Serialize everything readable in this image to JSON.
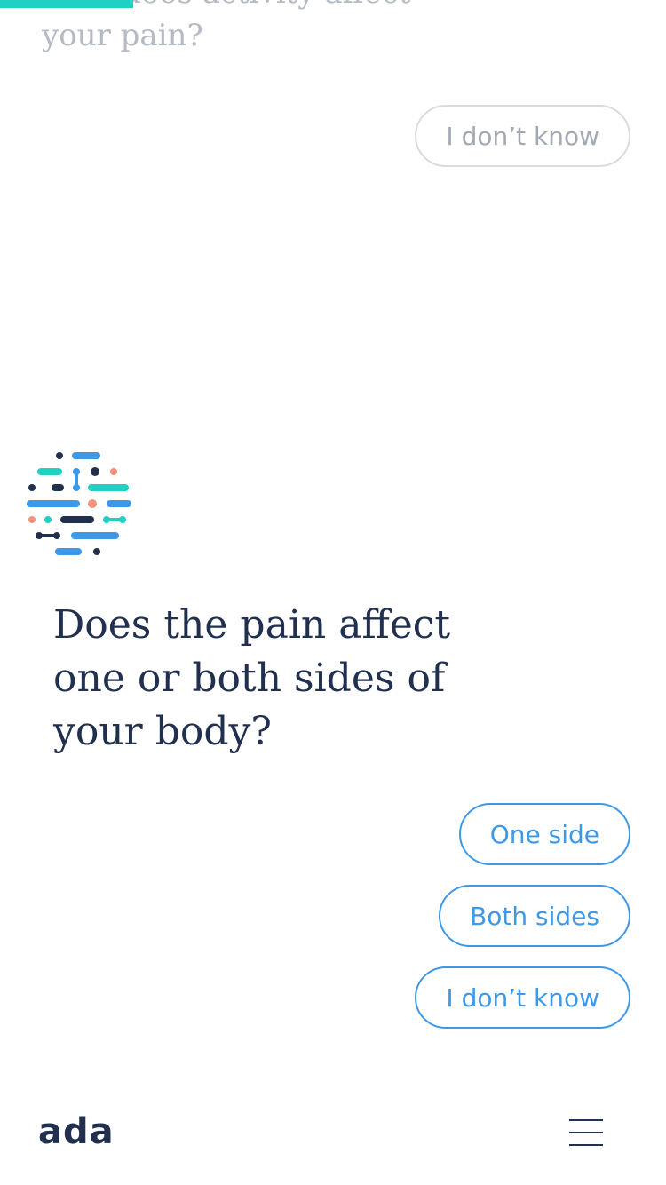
{
  "progress": {
    "value": 0.2,
    "color": "#20d1c3"
  },
  "previous": {
    "question": "How does activity affect your pain?",
    "answer_label": "I don’t know"
  },
  "current": {
    "question": "Does the pain affect one or both sides of your body?",
    "options": [
      {
        "label": "One side"
      },
      {
        "label": "Both sides"
      },
      {
        "label": "I don’t know"
      }
    ]
  },
  "footer": {
    "logo_text": "ada",
    "menu_icon": "hamburger-menu-icon"
  },
  "colors": {
    "accent": "#3d98e8",
    "teal": "#20d1c3",
    "navy": "#22304f",
    "coral": "#f5907a",
    "muted": "#b5bac4"
  }
}
